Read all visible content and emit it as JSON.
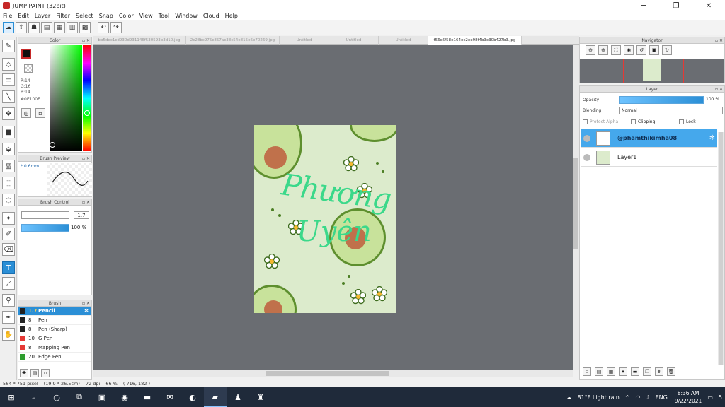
{
  "window": {
    "title": "JUMP PAINT (32bit)",
    "min": "─",
    "max": "❐",
    "close": "✕"
  },
  "menu": [
    "File",
    "Edit",
    "Layer",
    "Filter",
    "Select",
    "Snap",
    "Color",
    "View",
    "Tool",
    "Window",
    "Cloud",
    "Help"
  ],
  "toolbar": {
    "icons": [
      "cloud-icon",
      "export-icon",
      "cloud-upload-icon",
      "panel-icon",
      "page-icon",
      "layout-icon",
      "grid-icon"
    ],
    "undo": "↶",
    "redo": "↷"
  },
  "tools": [
    {
      "name": "pen-tool-icon",
      "glyph": "✎"
    },
    {
      "name": "eraser-tool-icon",
      "glyph": "◇"
    },
    {
      "name": "select-rect-tool-icon",
      "glyph": "▭"
    },
    {
      "name": "line-tool-icon",
      "glyph": "╲"
    },
    {
      "name": "move-tool-icon",
      "glyph": "✥"
    },
    {
      "name": "fill-rect-tool-icon",
      "glyph": "■"
    },
    {
      "name": "bucket-tool-icon",
      "glyph": "⬙"
    },
    {
      "name": "gradient-tool-icon",
      "glyph": "▨"
    },
    {
      "name": "marquee-tool-icon",
      "glyph": "⬚"
    },
    {
      "name": "lasso-tool-icon",
      "glyph": "◌"
    },
    {
      "name": "magic-wand-tool-icon",
      "glyph": "✦"
    },
    {
      "name": "select-pen-tool-icon",
      "glyph": "✐"
    },
    {
      "name": "select-eraser-tool-icon",
      "glyph": "⌫"
    },
    {
      "name": "text-tool-icon",
      "glyph": "T"
    },
    {
      "name": "operation-tool-icon",
      "glyph": "⤢"
    },
    {
      "name": "eyedropper-tool-icon",
      "glyph": "⚲"
    },
    {
      "name": "pen-color-tool-icon",
      "glyph": "✒"
    },
    {
      "name": "hand-tool-icon",
      "glyph": "✋"
    }
  ],
  "color_panel": {
    "title": "Color",
    "r": "R:14",
    "g": "G:16",
    "b": "B:14",
    "hex": "#0E100E",
    "fg_color": "#0E100E"
  },
  "brush_preview": {
    "title": "Brush Preview",
    "size": "* 0.6mm"
  },
  "brush_control": {
    "title": "Brush Control",
    "size_value": "1.7",
    "opacity_value": "100 %"
  },
  "brush_panel": {
    "title": "Brush",
    "items": [
      {
        "size": "1.7",
        "name": "Pencil",
        "color": "#222222",
        "selected": true
      },
      {
        "size": "8",
        "name": "Pen",
        "color": "#222222"
      },
      {
        "size": "8",
        "name": "Pen (Sharp)",
        "color": "#222222"
      },
      {
        "size": "10",
        "name": "G Pen",
        "color": "#e53935"
      },
      {
        "size": "8",
        "name": "Mapping Pen",
        "color": "#e53935"
      },
      {
        "size": "20",
        "name": "Edge Pen",
        "color": "#2e9d2e"
      }
    ]
  },
  "tabs": [
    {
      "label": "bb5dec1cd930d931146f530593b3d10.jpg"
    },
    {
      "label": "2c28bc975c857ac38c54e815e6e70269.jpg"
    },
    {
      "label": "Untitled"
    },
    {
      "label": "Untitled"
    },
    {
      "label": "Untitled"
    },
    {
      "label": "f56c6f58e164ec2ee98f4b3c30b427b3.jpg",
      "active": true
    }
  ],
  "artwork": {
    "line1": "Phương",
    "line2": "Uyên"
  },
  "navigator": {
    "title": "Navigator"
  },
  "layer_panel": {
    "title": "Layer",
    "opacity_label": "Opacity",
    "opacity_value": "100 %",
    "blending_label": "Blending",
    "blending_value": "Normal",
    "protect_alpha": "Protect Alpha",
    "clipping": "Clipping",
    "lock": "Lock",
    "layers": [
      {
        "name": "@phamthikimha08",
        "selected": true
      },
      {
        "name": "Layer1"
      }
    ]
  },
  "status": {
    "size": "564 * 751 pixel",
    "cm": "(19.9 * 26.5cm)",
    "dpi": "72 dpi",
    "zoom": "66 %",
    "coords": "( 716, 182 )"
  },
  "taskbar": {
    "weather": "81°F Light rain",
    "lang": "ENG",
    "time": "8:36 AM",
    "date": "9/22/2021",
    "notif": "5"
  }
}
